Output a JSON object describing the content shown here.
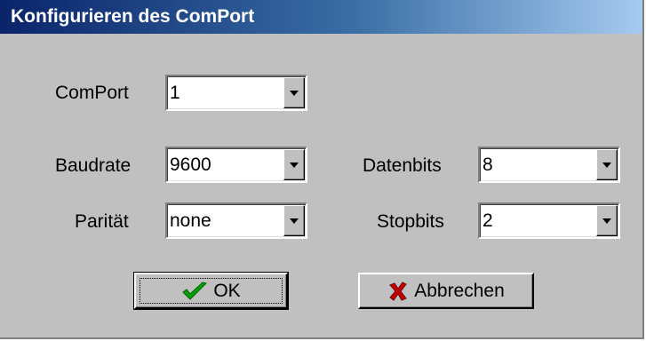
{
  "window": {
    "title": "Konfigurieren des ComPort"
  },
  "fields": {
    "comport": {
      "label": "ComPort",
      "value": "1"
    },
    "baudrate": {
      "label": "Baudrate",
      "value": "9600"
    },
    "paritaet": {
      "label": "Parität",
      "value": "none"
    },
    "datenbits": {
      "label": "Datenbits",
      "value": "8"
    },
    "stopbits": {
      "label": "Stopbits",
      "value": "2"
    }
  },
  "buttons": {
    "ok": {
      "label": "OK",
      "icon": "checkmark-icon",
      "color": "#00a000"
    },
    "cancel": {
      "label": "Abbrechen",
      "icon": "x-icon",
      "color": "#c00000"
    }
  },
  "colors": {
    "title_gradient_start": "#0a246a",
    "title_gradient_end": "#a6caf0",
    "face": "#c0c0c0"
  }
}
